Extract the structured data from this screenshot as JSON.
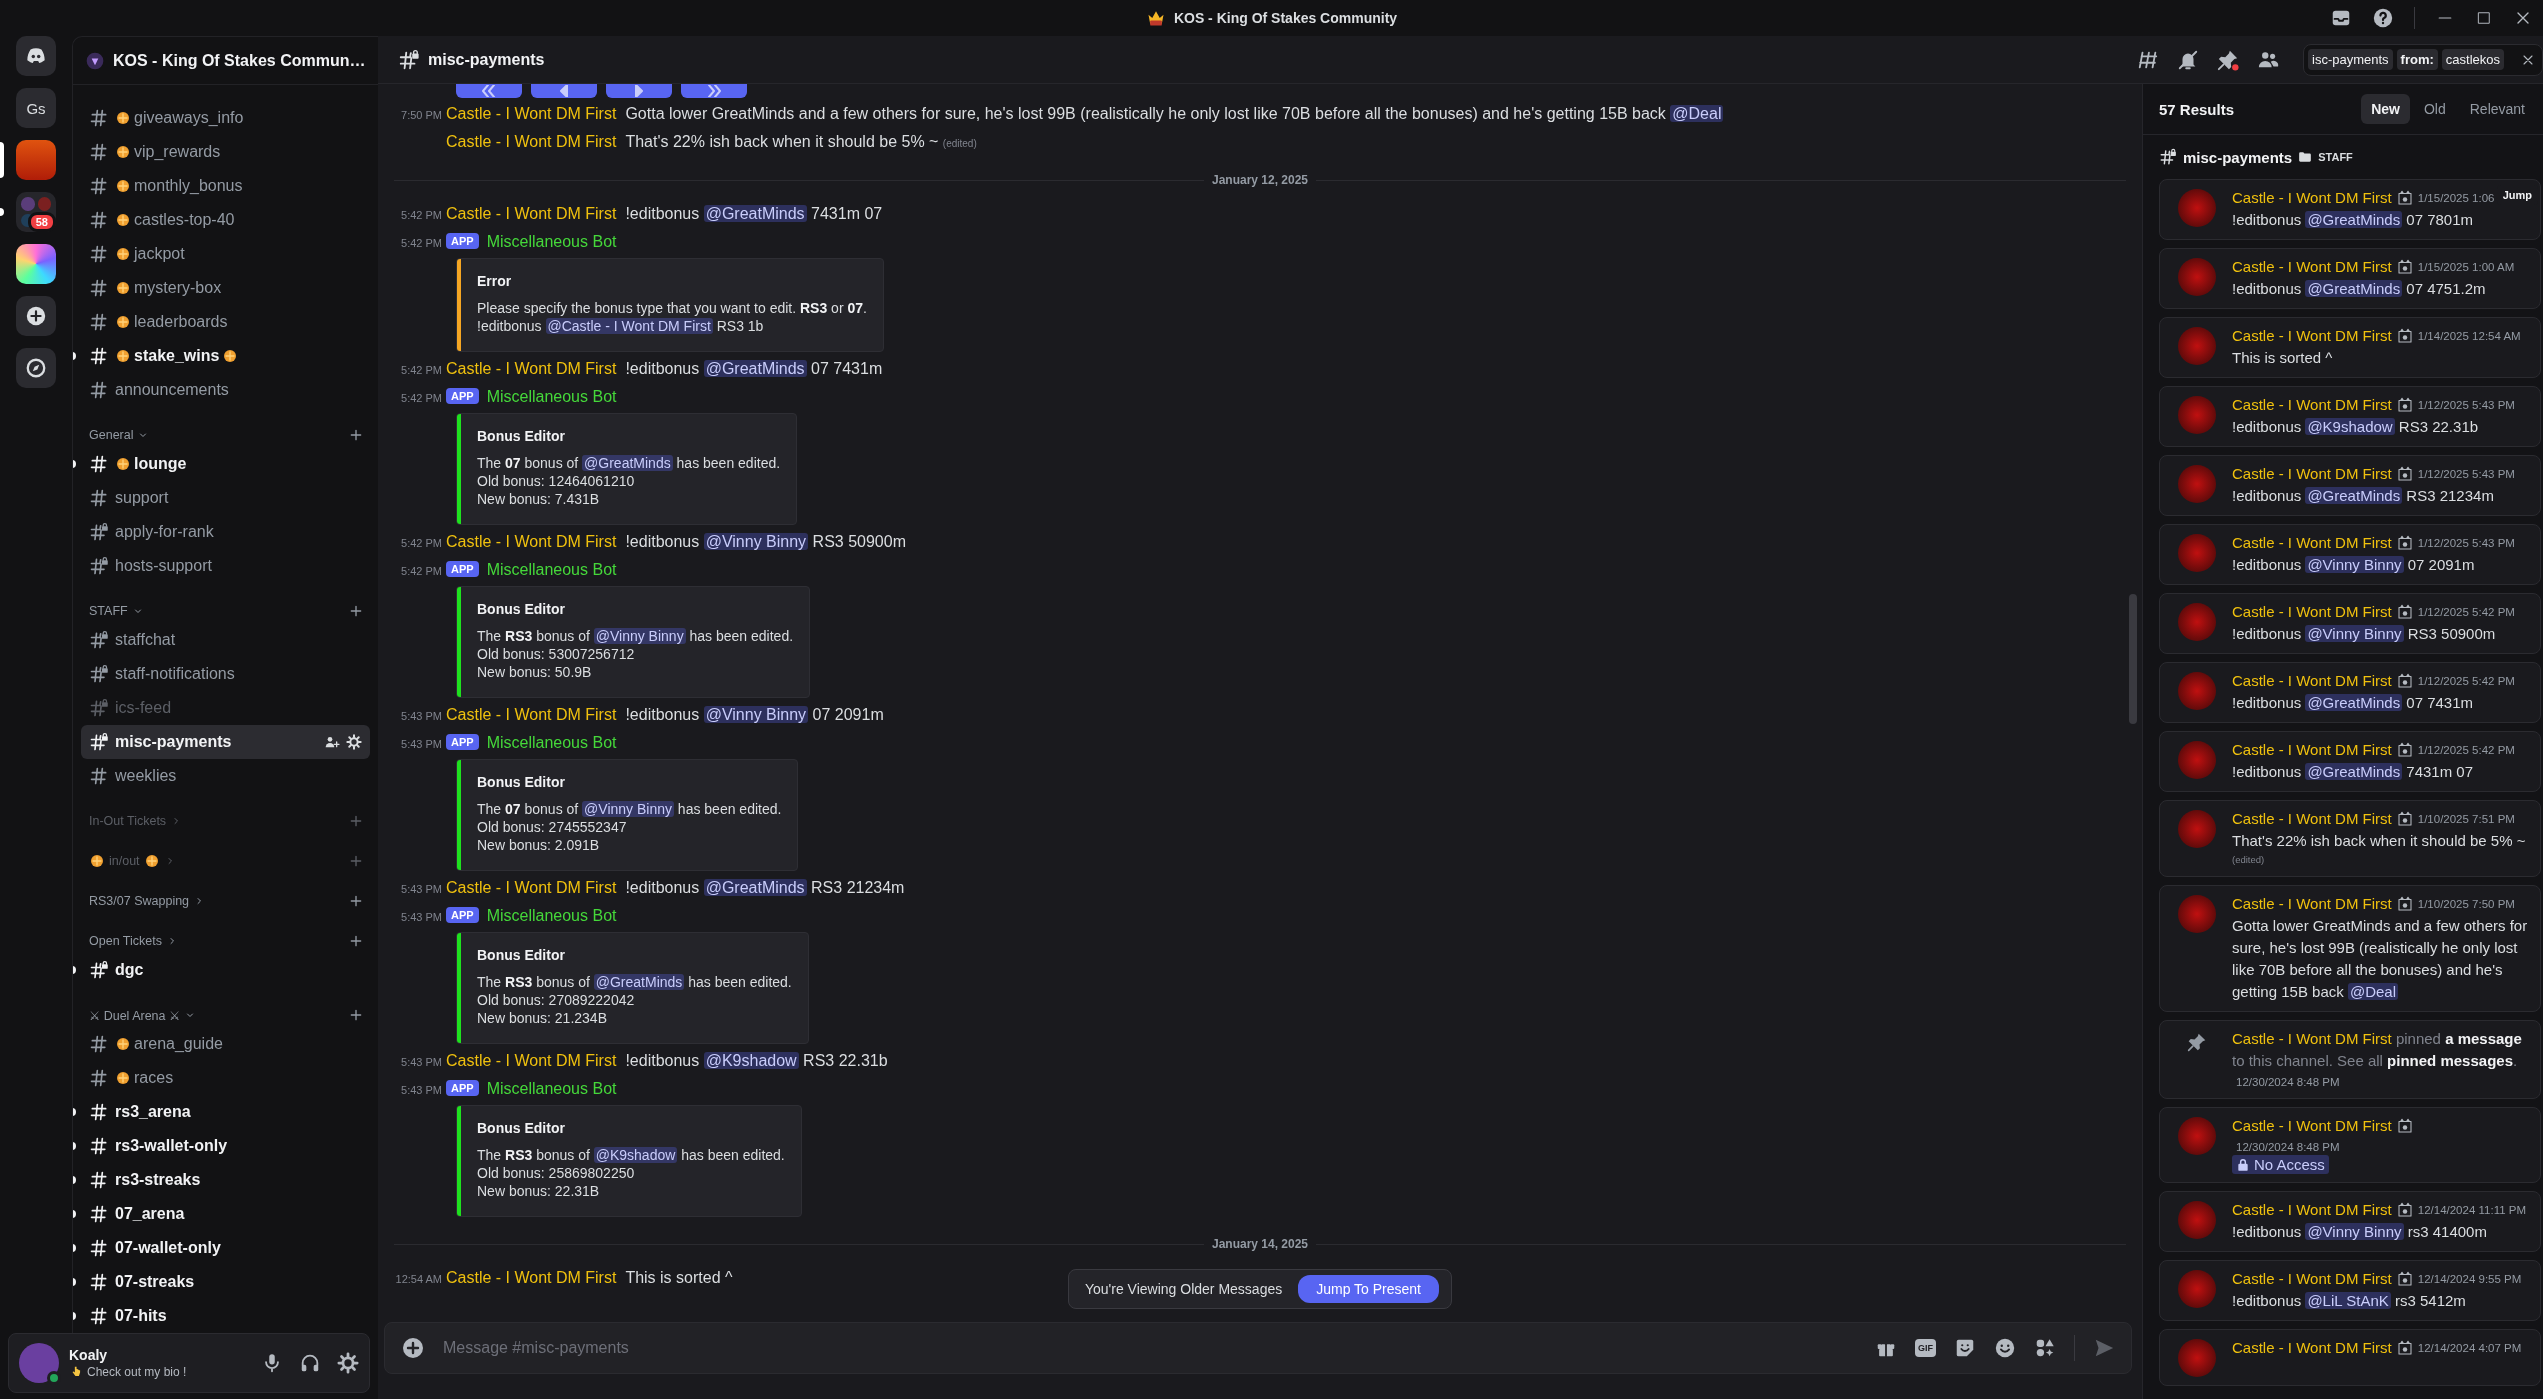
{
  "window": {
    "title": "KOS - King Of Stakes Community"
  },
  "rail": [
    {
      "kind": "home",
      "selected": false,
      "unread": false
    },
    {
      "kind": "text",
      "label": "Gs",
      "selected": false,
      "unread": false
    },
    {
      "kind": "server",
      "selected": true,
      "unread": false
    },
    {
      "kind": "folder",
      "badge": "58",
      "selected": false,
      "unread": true
    },
    {
      "kind": "app",
      "selected": false,
      "unread": false
    },
    {
      "kind": "add",
      "selected": false,
      "unread": false
    },
    {
      "kind": "discover",
      "selected": false,
      "unread": false
    }
  ],
  "sidebar": {
    "server_name": "KOS - King Of Stakes Commun…",
    "channels": [
      {
        "name": "giveaways_info",
        "kind": "text",
        "emoji_before": true,
        "emoji_after": false,
        "unread": false,
        "muted": false,
        "selected": false
      },
      {
        "name": "vip_rewards",
        "kind": "text",
        "emoji_before": true,
        "emoji_after": false,
        "unread": false,
        "muted": false,
        "selected": false
      },
      {
        "name": "monthly_bonus",
        "kind": "text",
        "emoji_before": true,
        "emoji_after": false,
        "unread": false,
        "muted": false,
        "selected": false
      },
      {
        "name": "castles-top-40",
        "kind": "text",
        "emoji_before": true,
        "emoji_after": false,
        "unread": false,
        "muted": false,
        "selected": false
      },
      {
        "name": "jackpot",
        "kind": "text",
        "emoji_before": true,
        "emoji_after": false,
        "unread": false,
        "muted": false,
        "selected": false
      },
      {
        "name": "mystery-box",
        "kind": "text",
        "emoji_before": true,
        "emoji_after": false,
        "unread": false,
        "muted": false,
        "selected": false
      },
      {
        "name": "leaderboards",
        "kind": "text",
        "emoji_before": true,
        "emoji_after": false,
        "unread": false,
        "muted": false,
        "selected": false
      },
      {
        "name": "stake_wins",
        "kind": "text",
        "emoji_before": true,
        "emoji_after": true,
        "unread": true,
        "muted": false,
        "selected": false
      },
      {
        "name": "announcements",
        "kind": "text",
        "emoji_before": false,
        "emoji_after": false,
        "unread": false,
        "muted": false,
        "selected": false
      }
    ],
    "categories": [
      {
        "name": "General",
        "emoji_before": false,
        "emoji_after": false,
        "expanded": true,
        "muted": false,
        "channels": [
          {
            "name": "lounge",
            "kind": "text",
            "emoji_before": true,
            "emoji_after": false,
            "unread": true,
            "muted": false,
            "selected": false
          },
          {
            "name": "support",
            "kind": "text",
            "emoji_before": false,
            "emoji_after": false,
            "unread": false,
            "muted": false,
            "selected": false
          },
          {
            "name": "apply-for-rank",
            "kind": "locked",
            "emoji_before": false,
            "emoji_after": false,
            "unread": false,
            "muted": false,
            "selected": false
          },
          {
            "name": "hosts-support",
            "kind": "locked",
            "emoji_before": false,
            "emoji_after": false,
            "unread": false,
            "muted": false,
            "selected": false
          }
        ]
      },
      {
        "name": "STAFF",
        "emoji_before": false,
        "emoji_after": false,
        "expanded": true,
        "muted": false,
        "channels": [
          {
            "name": "staffchat",
            "kind": "locked",
            "emoji_before": false,
            "emoji_after": false,
            "unread": false,
            "muted": false,
            "selected": false
          },
          {
            "name": "staff-notifications",
            "kind": "locked",
            "emoji_before": false,
            "emoji_after": false,
            "unread": false,
            "muted": false,
            "selected": false
          },
          {
            "name": "ics-feed",
            "kind": "locked",
            "emoji_before": false,
            "emoji_after": false,
            "unread": false,
            "muted": true,
            "selected": false
          },
          {
            "name": "misc-payments",
            "kind": "locked",
            "emoji_before": false,
            "emoji_after": false,
            "unread": false,
            "muted": false,
            "selected": true
          },
          {
            "name": "weeklies",
            "kind": "text",
            "emoji_before": false,
            "emoji_after": false,
            "unread": false,
            "muted": false,
            "selected": false
          }
        ]
      },
      {
        "name": "In-Out Tickets",
        "emoji_before": false,
        "emoji_after": false,
        "expanded": false,
        "muted": true
      },
      {
        "name": "in/out",
        "emoji_before": true,
        "emoji_after": true,
        "expanded": false,
        "muted": true
      },
      {
        "name": "RS3/07 Swapping",
        "emoji_before": false,
        "emoji_after": false,
        "expanded": false,
        "muted": false
      },
      {
        "name": "Open Tickets",
        "emoji_before": false,
        "emoji_after": false,
        "expanded": false,
        "muted": false,
        "channels": [
          {
            "name": "dgc",
            "kind": "locked",
            "emoji_before": false,
            "emoji_after": false,
            "unread": true,
            "muted": false,
            "selected": false
          }
        ]
      },
      {
        "name": "⚔ Duel Arena ⚔",
        "emoji_before": false,
        "emoji_after": false,
        "expanded": true,
        "muted": false,
        "channels": [
          {
            "name": "arena_guide",
            "kind": "text",
            "emoji_before": true,
            "emoji_after": false,
            "unread": false,
            "muted": false,
            "selected": false
          },
          {
            "name": "races",
            "kind": "text",
            "emoji_before": true,
            "emoji_after": false,
            "unread": false,
            "muted": false,
            "selected": false
          },
          {
            "name": "rs3_arena",
            "kind": "text",
            "emoji_before": false,
            "emoji_after": false,
            "unread": true,
            "muted": false,
            "selected": false
          },
          {
            "name": "rs3-wallet-only",
            "kind": "text",
            "emoji_before": false,
            "emoji_after": false,
            "unread": true,
            "muted": false,
            "selected": false
          },
          {
            "name": "rs3-streaks",
            "kind": "text",
            "emoji_before": false,
            "emoji_after": false,
            "unread": true,
            "muted": false,
            "selected": false
          },
          {
            "name": "07_arena",
            "kind": "text",
            "emoji_before": false,
            "emoji_after": false,
            "unread": true,
            "muted": false,
            "selected": false
          },
          {
            "name": "07-wallet-only",
            "kind": "text",
            "emoji_before": false,
            "emoji_after": false,
            "unread": true,
            "muted": false,
            "selected": false
          },
          {
            "name": "07-streaks",
            "kind": "text",
            "emoji_before": false,
            "emoji_after": false,
            "unread": true,
            "muted": false,
            "selected": false
          },
          {
            "name": "07-hits",
            "kind": "text",
            "emoji_before": false,
            "emoji_after": false,
            "unread": true,
            "muted": false,
            "selected": false
          }
        ]
      }
    ]
  },
  "user": {
    "name": "Koaly",
    "status": "Check out my bio !",
    "online": true
  },
  "header": {
    "channel": "misc-payments",
    "pins_unread": true,
    "search": [
      {
        "kind": "filter",
        "text": "isc-payments"
      },
      {
        "kind": "key",
        "text": "from:"
      },
      {
        "kind": "value",
        "text": "castlekos"
      }
    ]
  },
  "chat": {
    "messages": [
      {
        "kind": "buttons",
        "buttons": [
          {
            "kind": "first"
          },
          {
            "kind": "prev"
          },
          {
            "kind": "next"
          },
          {
            "kind": "last"
          }
        ]
      },
      {
        "kind": "user",
        "time": "7:50 PM",
        "author": "Castle - I Wont DM First",
        "color": "#f0c10e",
        "body": [
          {
            "kind": "text",
            "text": "Gotta lower GreatMinds and a few others for sure, he's lost 99B (realistically he only lost like 70B before all the bonuses) and he's getting 15B back"
          },
          {
            "kind": "mention",
            "text": "@Deal"
          }
        ]
      },
      {
        "kind": "user",
        "author": "Castle - I Wont DM First",
        "color": "#f0c10e",
        "body": [
          {
            "kind": "text",
            "text": "That's 22% ish back when it should be 5% ~"
          }
        ],
        "edited": "(edited)"
      },
      {
        "kind": "divider",
        "label": "January 12, 2025"
      },
      {
        "kind": "user",
        "time": "5:42 PM",
        "author": "Castle - I Wont DM First",
        "color": "#f0c10e",
        "body": [
          {
            "kind": "text",
            "text": "!editbonus"
          },
          {
            "kind": "mention",
            "text": "@GreatMinds"
          },
          {
            "kind": "text",
            "text": "7431m 07"
          }
        ]
      },
      {
        "kind": "bot",
        "time": "5:42 PM",
        "tag": "APP",
        "author": "Miscellaneous Bot",
        "color": "#45d83a",
        "embed": {
          "color": "#f5a623",
          "title": "Error",
          "lines": [
            [
              {
                "kind": "text",
                "text": "Please specify the bonus type that you want to edit. **RS3** or **07**."
              }
            ],
            [
              {
                "kind": "text",
                "text": "!editbonus"
              },
              {
                "kind": "mention",
                "text": "@Castle - I Wont DM First"
              },
              {
                "kind": "text",
                "text": "RS3 1b"
              }
            ]
          ]
        }
      },
      {
        "kind": "user",
        "time": "5:42 PM",
        "author": "Castle - I Wont DM First",
        "color": "#f0c10e",
        "body": [
          {
            "kind": "text",
            "text": "!editbonus"
          },
          {
            "kind": "mention",
            "text": "@GreatMinds"
          },
          {
            "kind": "text",
            "text": "07 7431m"
          }
        ]
      },
      {
        "kind": "bot",
        "time": "5:42 PM",
        "tag": "APP",
        "author": "Miscellaneous Bot",
        "color": "#45d83a",
        "embed": {
          "color": "#1ee11e",
          "title": "Bonus Editor",
          "lines": [
            [
              {
                "kind": "text",
                "text": "The **07** bonus of"
              },
              {
                "kind": "mention",
                "text": "@GreatMinds"
              },
              {
                "kind": "text",
                "text": "has been edited."
              }
            ],
            [
              {
                "kind": "text",
                "text": "Old bonus: 12464061210"
              }
            ],
            [
              {
                "kind": "text",
                "text": "New bonus: 7.431B"
              }
            ]
          ]
        }
      },
      {
        "kind": "user",
        "time": "5:42 PM",
        "author": "Castle - I Wont DM First",
        "color": "#f0c10e",
        "body": [
          {
            "kind": "text",
            "text": "!editbonus"
          },
          {
            "kind": "mention",
            "text": "@Vinny Binny"
          },
          {
            "kind": "text",
            "text": "RS3 50900m"
          }
        ]
      },
      {
        "kind": "bot",
        "time": "5:42 PM",
        "tag": "APP",
        "author": "Miscellaneous Bot",
        "color": "#45d83a",
        "embed": {
          "color": "#1ee11e",
          "title": "Bonus Editor",
          "lines": [
            [
              {
                "kind": "text",
                "text": "The **RS3** bonus of"
              },
              {
                "kind": "mention",
                "text": "@Vinny Binny"
              },
              {
                "kind": "text",
                "text": "has been edited."
              }
            ],
            [
              {
                "kind": "text",
                "text": "Old bonus: 53007256712"
              }
            ],
            [
              {
                "kind": "text",
                "text": "New bonus: 50.9B"
              }
            ]
          ]
        }
      },
      {
        "kind": "user",
        "time": "5:43 PM",
        "author": "Castle - I Wont DM First",
        "color": "#f0c10e",
        "body": [
          {
            "kind": "text",
            "text": "!editbonus"
          },
          {
            "kind": "mention",
            "text": "@Vinny Binny"
          },
          {
            "kind": "text",
            "text": "07 2091m"
          }
        ]
      },
      {
        "kind": "bot",
        "time": "5:43 PM",
        "tag": "APP",
        "author": "Miscellaneous Bot",
        "color": "#45d83a",
        "embed": {
          "color": "#1ee11e",
          "title": "Bonus Editor",
          "lines": [
            [
              {
                "kind": "text",
                "text": "The **07** bonus of"
              },
              {
                "kind": "mention",
                "text": "@Vinny Binny"
              },
              {
                "kind": "text",
                "text": "has been edited."
              }
            ],
            [
              {
                "kind": "text",
                "text": "Old bonus: 2745552347"
              }
            ],
            [
              {
                "kind": "text",
                "text": "New bonus: 2.091B"
              }
            ]
          ]
        }
      },
      {
        "kind": "user",
        "time": "5:43 PM",
        "author": "Castle - I Wont DM First",
        "color": "#f0c10e",
        "body": [
          {
            "kind": "text",
            "text": "!editbonus"
          },
          {
            "kind": "mention",
            "text": "@GreatMinds"
          },
          {
            "kind": "text",
            "text": "RS3 21234m"
          }
        ]
      },
      {
        "kind": "bot",
        "time": "5:43 PM",
        "tag": "APP",
        "author": "Miscellaneous Bot",
        "color": "#45d83a",
        "embed": {
          "color": "#1ee11e",
          "title": "Bonus Editor",
          "lines": [
            [
              {
                "kind": "text",
                "text": "The **RS3** bonus of"
              },
              {
                "kind": "mention",
                "text": "@GreatMinds"
              },
              {
                "kind": "text",
                "text": "has been edited."
              }
            ],
            [
              {
                "kind": "text",
                "text": "Old bonus: 27089222042"
              }
            ],
            [
              {
                "kind": "text",
                "text": "New bonus: 21.234B"
              }
            ]
          ]
        }
      },
      {
        "kind": "user",
        "time": "5:43 PM",
        "author": "Castle - I Wont DM First",
        "color": "#f0c10e",
        "body": [
          {
            "kind": "text",
            "text": "!editbonus"
          },
          {
            "kind": "mention",
            "text": "@K9shadow"
          },
          {
            "kind": "text",
            "text": "RS3 22.31b"
          }
        ]
      },
      {
        "kind": "bot",
        "time": "5:43 PM",
        "tag": "APP",
        "author": "Miscellaneous Bot",
        "color": "#45d83a",
        "embed": {
          "color": "#1ee11e",
          "title": "Bonus Editor",
          "lines": [
            [
              {
                "kind": "text",
                "text": "The **RS3** bonus of"
              },
              {
                "kind": "mention",
                "text": "@K9shadow"
              },
              {
                "kind": "text",
                "text": "has been edited."
              }
            ],
            [
              {
                "kind": "text",
                "text": "Old bonus: 25869802250"
              }
            ],
            [
              {
                "kind": "text",
                "text": "New bonus: 22.31B"
              }
            ]
          ]
        }
      },
      {
        "kind": "divider",
        "label": "January 14, 2025"
      },
      {
        "kind": "user",
        "time": "12:54 AM",
        "author": "Castle - I Wont DM First",
        "color": "#f0c10e",
        "body": [
          {
            "kind": "text",
            "text": "This is sorted ^"
          }
        ]
      }
    ],
    "jump_bar": {
      "text": "You're Viewing Older Messages",
      "button": "Jump To Present"
    },
    "composer": {
      "placeholder": "Message #misc-payments",
      "gif_label": "GIF"
    }
  },
  "results": {
    "count": "57 Results",
    "sort": [
      {
        "label": "New",
        "selected": true
      },
      {
        "label": "Old",
        "selected": false
      },
      {
        "label": "Relevant",
        "selected": false
      }
    ],
    "channel": "misc-payments",
    "category": "STAFF",
    "items": [
      {
        "kind": "message",
        "author": "Castle - I Wont DM First",
        "color": "#f0c10e",
        "time": "1/15/2025 1:06",
        "jump": "Jump",
        "body": [
          {
            "kind": "text",
            "text": "!editbonus"
          },
          {
            "kind": "mention",
            "text": "@GreatMinds"
          },
          {
            "kind": "text",
            "text": "07 7801m"
          }
        ]
      },
      {
        "kind": "message",
        "author": "Castle - I Wont DM First",
        "color": "#f0c10e",
        "time": "1/15/2025 1:00 AM",
        "body": [
          {
            "kind": "text",
            "text": "!editbonus"
          },
          {
            "kind": "mention",
            "text": "@GreatMinds"
          },
          {
            "kind": "text",
            "text": "07 4751.2m"
          }
        ]
      },
      {
        "kind": "message",
        "author": "Castle - I Wont DM First",
        "color": "#f0c10e",
        "time": "1/14/2025 12:54 AM",
        "body": [
          {
            "kind": "text",
            "text": "This is sorted ^"
          }
        ]
      },
      {
        "kind": "message",
        "author": "Castle - I Wont DM First",
        "color": "#f0c10e",
        "time": "1/12/2025 5:43 PM",
        "body": [
          {
            "kind": "text",
            "text": "!editbonus"
          },
          {
            "kind": "mention",
            "text": "@K9shadow"
          },
          {
            "kind": "text",
            "text": "RS3 22.31b"
          }
        ]
      },
      {
        "kind": "message",
        "author": "Castle - I Wont DM First",
        "color": "#f0c10e",
        "time": "1/12/2025 5:43 PM",
        "body": [
          {
            "kind": "text",
            "text": "!editbonus"
          },
          {
            "kind": "mention",
            "text": "@GreatMinds"
          },
          {
            "kind": "text",
            "text": "RS3 21234m"
          }
        ]
      },
      {
        "kind": "message",
        "author": "Castle - I Wont DM First",
        "color": "#f0c10e",
        "time": "1/12/2025 5:43 PM",
        "body": [
          {
            "kind": "text",
            "text": "!editbonus"
          },
          {
            "kind": "mention",
            "text": "@Vinny Binny"
          },
          {
            "kind": "text",
            "text": "07 2091m"
          }
        ]
      },
      {
        "kind": "message",
        "author": "Castle - I Wont DM First",
        "color": "#f0c10e",
        "time": "1/12/2025 5:42 PM",
        "body": [
          {
            "kind": "text",
            "text": "!editbonus"
          },
          {
            "kind": "mention",
            "text": "@Vinny Binny"
          },
          {
            "kind": "text",
            "text": "RS3 50900m"
          }
        ]
      },
      {
        "kind": "message",
        "author": "Castle - I Wont DM First",
        "color": "#f0c10e",
        "time": "1/12/2025 5:42 PM",
        "body": [
          {
            "kind": "text",
            "text": "!editbonus"
          },
          {
            "kind": "mention",
            "text": "@GreatMinds"
          },
          {
            "kind": "text",
            "text": "07 7431m"
          }
        ]
      },
      {
        "kind": "message",
        "author": "Castle - I Wont DM First",
        "color": "#f0c10e",
        "time": "1/12/2025 5:42 PM",
        "body": [
          {
            "kind": "text",
            "text": "!editbonus"
          },
          {
            "kind": "mention",
            "text": "@GreatMinds"
          },
          {
            "kind": "text",
            "text": "7431m 07"
          }
        ]
      },
      {
        "kind": "message",
        "author": "Castle - I Wont DM First",
        "color": "#f0c10e",
        "time": "1/10/2025 7:51 PM",
        "body": [
          {
            "kind": "text",
            "text": "That's 22% ish back when it should be 5% ~"
          }
        ],
        "edited": "(edited)"
      },
      {
        "kind": "message",
        "author": "Castle - I Wont DM First",
        "color": "#f0c10e",
        "time": "1/10/2025 7:50 PM",
        "body": [
          {
            "kind": "text",
            "text": "Gotta lower GreatMinds and a few others for sure, he's lost 99B (realistically he only lost like 70B before all the bonuses) and he's getting 15B back"
          },
          {
            "kind": "mention",
            "text": "@Deal"
          }
        ]
      },
      {
        "kind": "pin",
        "author": "Castle - I Wont DM First",
        "color": "#f0c10e",
        "text": "pinned **a message** to this channel. See all **pinned messages**.",
        "time": "12/30/2024 8:48 PM"
      },
      {
        "kind": "no_access",
        "author": "Castle - I Wont DM First",
        "color": "#f0c10e",
        "time": "12/30/2024 8:48 PM",
        "label": "No Access"
      },
      {
        "kind": "message",
        "author": "Castle - I Wont DM First",
        "color": "#f0c10e",
        "time": "12/14/2024 11:11 PM",
        "body": [
          {
            "kind": "text",
            "text": "!editbonus"
          },
          {
            "kind": "mention",
            "text": "@Vinny Binny"
          },
          {
            "kind": "text",
            "text": "rs3 41400m"
          }
        ]
      },
      {
        "kind": "message",
        "author": "Castle - I Wont DM First",
        "color": "#f0c10e",
        "time": "12/14/2024 9:55 PM",
        "body": [
          {
            "kind": "text",
            "text": "!editbonus"
          },
          {
            "kind": "mention",
            "text": "@LiL StAnK"
          },
          {
            "kind": "text",
            "text": "rs3 5412m"
          }
        ]
      },
      {
        "kind": "message",
        "author": "Castle - I Wont DM First",
        "color": "#f0c10e",
        "time": "12/14/2024 4:07 PM"
      }
    ]
  }
}
